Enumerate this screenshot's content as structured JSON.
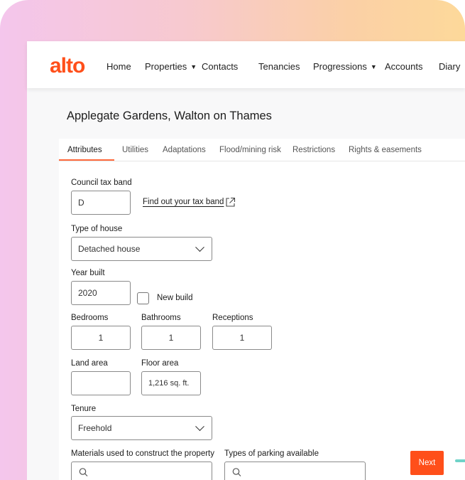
{
  "app": {
    "logo": "alto"
  },
  "nav": {
    "home": "Home",
    "properties": "Properties",
    "contacts": "Contacts",
    "tenancies": "Tenancies",
    "progressions": "Progressions",
    "accounts": "Accounts",
    "diary": "Diary",
    "caret": "▼"
  },
  "page": {
    "title": "Applegate Gardens, Walton on Thames"
  },
  "tabs": [
    "Attributes",
    "Utilities",
    "Adaptations",
    "Flood/mining risk",
    "Restrictions",
    "Rights & easements"
  ],
  "form": {
    "council_tax": {
      "label": "Council tax band",
      "value": "D",
      "link": "Find out your tax band"
    },
    "house_type": {
      "label": "Type of house",
      "value": "Detached house"
    },
    "year_built": {
      "label": "Year built",
      "value": "2020",
      "new_build_label": "New build",
      "new_build_checked": false
    },
    "bedrooms": {
      "label": "Bedrooms",
      "value": "1"
    },
    "bathrooms": {
      "label": "Bathrooms",
      "value": "1"
    },
    "receptions": {
      "label": "Receptions",
      "value": "1"
    },
    "land_area": {
      "label": "Land area",
      "value": ""
    },
    "floor_area": {
      "label": "Floor area",
      "value": "1,216 sq. ft."
    },
    "tenure": {
      "label": "Tenure",
      "value": "Freehold"
    },
    "materials": {
      "label": "Materials used to construct the property"
    },
    "parking": {
      "label": "Types of parking available"
    }
  },
  "actions": {
    "next": "Next"
  },
  "colors": {
    "accent": "#ff4f1a",
    "tab_underline": "#ff6a3d"
  },
  "icons": [
    "external-link-icon",
    "chevron-down-icon",
    "search-icon"
  ]
}
